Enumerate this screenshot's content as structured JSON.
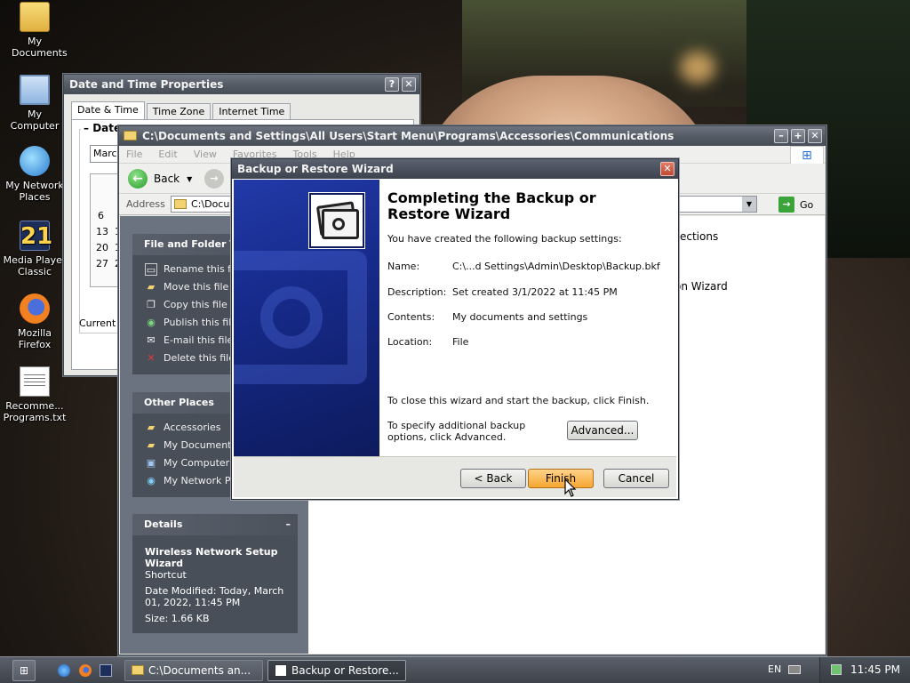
{
  "desktop": {
    "icons": [
      {
        "label": "My Documents",
        "icon": "folder-icon"
      },
      {
        "label": "My Computer",
        "icon": "computer-icon"
      },
      {
        "label": "My Network Places",
        "icon": "network-icon"
      },
      {
        "label": "Media Player Classic",
        "icon": "media-player-icon"
      },
      {
        "label": "Mozilla Firefox",
        "icon": "firefox-icon"
      },
      {
        "label": "Recomme... Programs.txt",
        "icon": "text-file-icon"
      }
    ]
  },
  "datetime_window": {
    "title": "Date and Time Properties",
    "tabs": [
      "Date & Time",
      "Time Zone",
      "Internet Time"
    ],
    "group_label": "Date",
    "month_value": "March",
    "calendar_days": [
      "6",
      "13",
      "20",
      "27"
    ],
    "calendar_days_col2": [
      "1",
      "1",
      "2"
    ],
    "current_label": "Current t"
  },
  "explorer": {
    "title": "C:\\Documents and Settings\\All Users\\Start Menu\\Programs\\Accessories\\Communications",
    "menu": [
      "File",
      "Edit",
      "View",
      "Favorites",
      "Tools",
      "Help"
    ],
    "back_label": "Back",
    "address_label": "Address",
    "address_value": "C:\\Docu",
    "go_label": "Go",
    "file_tasks": {
      "title": "File and Folder Ta",
      "items": [
        "Rename this file",
        "Move this file",
        "Copy this file",
        "Publish this file",
        "E-mail this file",
        "Delete this file"
      ]
    },
    "other_places": {
      "title": "Other Places",
      "items": [
        "Accessories",
        "My Documents",
        "My Computer",
        "My Network Pla"
      ]
    },
    "details": {
      "title": "Details",
      "name": "Wireless Network Setup Wizard",
      "type": "Shortcut",
      "modified": "Date Modified: Today, March 01, 2022, 11:45 PM",
      "size": "Size: 1.66 KB"
    },
    "content_items": [
      "ections",
      "on Wizard"
    ]
  },
  "wizard": {
    "title": "Backup or Restore Wizard",
    "heading": "Completing the Backup or Restore Wizard",
    "intro": "You have created the following backup settings:",
    "fields": [
      {
        "label": "Name:",
        "value": "C:\\...d Settings\\Admin\\Desktop\\Backup.bkf"
      },
      {
        "label": "Description:",
        "value": "Set created 3/1/2022 at 11:45 PM"
      },
      {
        "label": "Contents:",
        "value": "My documents and settings"
      },
      {
        "label": "Location:",
        "value": "File"
      }
    ],
    "close_text": "To close this wizard and start the backup, click Finish.",
    "advanced_text": "To specify additional backup options, click Advanced.",
    "advanced_button": "Advanced...",
    "back_button": "< Back",
    "finish_button": "Finish",
    "cancel_button": "Cancel"
  },
  "taskbar": {
    "tasks": [
      {
        "label": "C:\\Documents an...",
        "icon": "folder-icon"
      },
      {
        "label": "Backup or Restore...",
        "icon": "backup-icon"
      }
    ],
    "language": "EN",
    "clock": "11:45 PM"
  }
}
